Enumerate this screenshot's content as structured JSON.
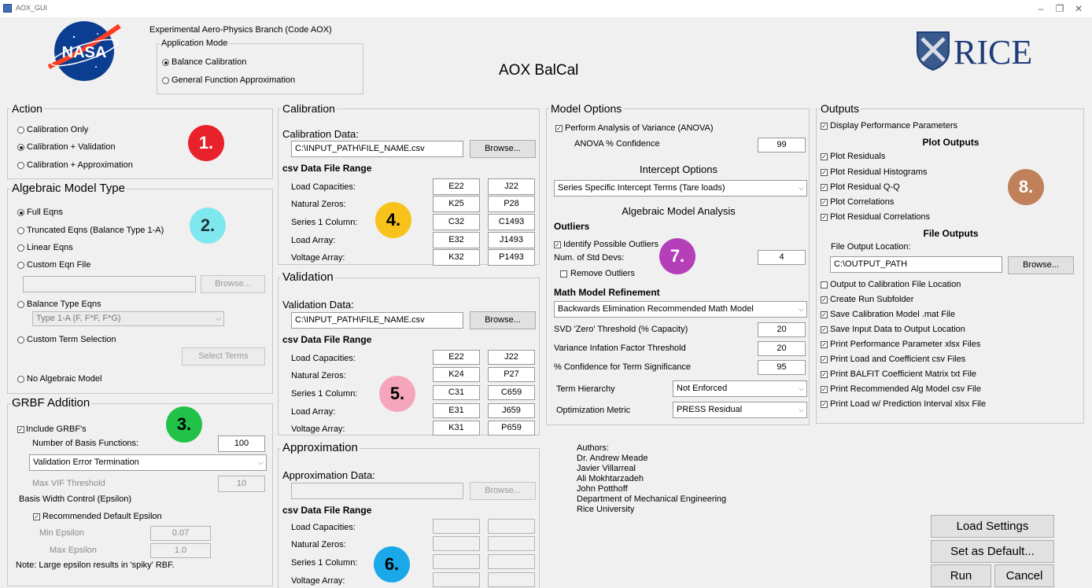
{
  "window": {
    "title": "AOX_GUI",
    "min": "–",
    "restore": "❐",
    "close": "✕"
  },
  "header": {
    "branch": "Experimental Aero-Physics Branch (Code AOX)",
    "app_mode_title": "Application Mode",
    "mode_balance": "Balance Calibration",
    "mode_gfa": "General Function Approximation",
    "app_title": "AOX  BalCal",
    "nasa_logo": "NASA",
    "rice_logo": "RICE"
  },
  "action": {
    "title": "Action",
    "opt1": "Calibration Only",
    "opt2": "Calibration + Validation",
    "opt3": "Calibration + Approximation",
    "badge": "1."
  },
  "algebraic": {
    "title": "Algebraic Model Type",
    "opt_full": "Full Eqns",
    "opt_trunc": "Truncated Eqns (Balance Type 1-A)",
    "opt_linear": "Linear Eqns",
    "opt_custom_file": "Custom Eqn File",
    "browse": "Browse...",
    "opt_balance": "Balance Type Eqns",
    "balance_select": "Type 1-A (F, F*F, F*G)",
    "opt_custom_term": "Custom Term Selection",
    "select_terms": "Select Terms",
    "opt_none": "No Algebraic Model",
    "badge": "2."
  },
  "grbf": {
    "title": "GRBF Addition",
    "include": "Include GRBF's",
    "num_label": "Number of Basis Functions:",
    "num_value": "100",
    "termination": "Validation Error Termination",
    "vif_label": "Max VIF Threshold",
    "vif_value": "10",
    "width_label": "Basis Width Control (Epsilon)",
    "rec_label": "Recommended Default Epsilon",
    "min_label": "Min Epsilon",
    "min_value": "0.07",
    "max_label": "Max Epsilon",
    "max_value": "1.0",
    "note": "Note: Large epsilon results in 'spiky' RBF.",
    "badge": "3."
  },
  "calibration": {
    "title": "Calibration",
    "data_label": "Calibration Data:",
    "path": "C:\\INPUT_PATH\\FILE_NAME.csv",
    "browse": "Browse...",
    "range_label": "csv Data File Range",
    "rows": [
      {
        "label": "Load Capacities:",
        "a": "E22",
        "b": "J22"
      },
      {
        "label": "Natural Zeros:",
        "a": "K25",
        "b": "P28"
      },
      {
        "label": "Series 1 Column:",
        "a": "C32",
        "b": "C1493"
      },
      {
        "label": "Load Array:",
        "a": "E32",
        "b": "J1493"
      },
      {
        "label": "Voltage Array:",
        "a": "K32",
        "b": "P1493"
      }
    ],
    "badge": "4."
  },
  "validation": {
    "title": "Validation",
    "data_label": "Validation Data:",
    "path": "C:\\INPUT_PATH\\FILE_NAME.csv",
    "browse": "Browse...",
    "range_label": "csv Data File Range",
    "rows": [
      {
        "label": "Load Capacities:",
        "a": "E22",
        "b": "J22"
      },
      {
        "label": "Natural Zeros:",
        "a": "K24",
        "b": "P27"
      },
      {
        "label": "Series 1 Column:",
        "a": "C31",
        "b": "C659"
      },
      {
        "label": "Load Array:",
        "a": "E31",
        "b": "J659"
      },
      {
        "label": "Voltage Array:",
        "a": "K31",
        "b": "P659"
      }
    ],
    "badge": "5."
  },
  "approximation": {
    "title": "Approximation",
    "data_label": "Approximation Data:",
    "browse": "Browse...",
    "range_label": "csv Data File Range",
    "rows": [
      {
        "label": "Load Capacities:"
      },
      {
        "label": "Natural Zeros:"
      },
      {
        "label": "Series 1 Column:"
      },
      {
        "label": "Voltage Array:"
      }
    ],
    "badge": "6."
  },
  "model": {
    "title": "Model Options",
    "anova": "Perform Analysis of Variance (ANOVA)",
    "anova_conf_label": "ANOVA % Confidence",
    "anova_conf": "99",
    "intercept_title": "Intercept Options",
    "intercept_select": "Series Specific Intercept Terms (Tare loads)",
    "alg_analysis": "Algebraic Model Analysis",
    "outliers": "Outliers",
    "identify": "Identify Possible Outliers",
    "std_label": "Num. of Std Devs:",
    "std_value": "4",
    "remove": "Remove Outliers",
    "refine": "Math Model Refinement",
    "refine_select": "Backwards Elimination Recommended Math Model",
    "svd_label": "SVD 'Zero' Threshold (% Capacity)",
    "svd_value": "20",
    "vif_label": "Variance Infation Factor Threshold",
    "vif_value": "20",
    "conf_label": "% Confidence for Term Significance",
    "conf_value": "95",
    "hier_label": "Term Hierarchy",
    "hier_value": "Not Enforced",
    "opt_label": "Optimization Metric",
    "opt_value": "PRESS Residual",
    "badge": "7."
  },
  "authors": {
    "lines": [
      "Authors:",
      "Dr. Andrew Meade",
      "Javier Villarreal",
      "Ali Mokhtarzadeh",
      "John Potthoff",
      "Department of Mechanical Engineering",
      "Rice University"
    ]
  },
  "outputs": {
    "title": "Outputs",
    "display": "Display Performance Parameters",
    "plot_title": "Plot Outputs",
    "plots": [
      "Plot Residuals",
      "Plot Residual Histograms",
      "Plot Residual Q-Q",
      "Plot Correlations",
      "Plot Residual Correlations"
    ],
    "file_title": "File Outputs",
    "loc_label": "File Output Location:",
    "loc_value": "C:\\OUTPUT_PATH",
    "browse": "Browse...",
    "files": [
      {
        "label": "Output to Calibration File Location",
        "checked": false
      },
      {
        "label": "Create Run Subfolder",
        "checked": true
      },
      {
        "label": "Save Calibration Model .mat File",
        "checked": true
      },
      {
        "label": "Save Input Data to Output Location",
        "checked": true
      },
      {
        "label": "Print Performance Parameter xlsx Files",
        "checked": true
      },
      {
        "label": "Print Load and Coefficient csv Files",
        "checked": true
      },
      {
        "label": "Print BALFIT Coefficient Matrix txt File",
        "checked": true
      },
      {
        "label": "Print Recommended Alg Model csv File",
        "checked": true
      },
      {
        "label": "Print Load w/ Prediction Interval xlsx File",
        "checked": true
      }
    ],
    "badge": "8."
  },
  "buttons": {
    "load": "Load Settings",
    "default": "Set as Default...",
    "run": "Run",
    "cancel": "Cancel"
  },
  "colors": {
    "badge1": "#e8212a",
    "badge2": "#7fe8ee",
    "badge3": "#22c24a",
    "badge4": "#f7c31a",
    "badge5": "#f6a6bb",
    "badge6": "#1ba8e8",
    "badge7": "#b43fb8",
    "badge8": "#c0815a",
    "rice_blue": "#1f3d7a",
    "nasa_blue": "#0b3d91"
  }
}
